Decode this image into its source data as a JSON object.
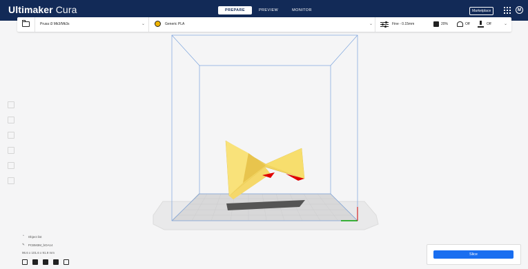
{
  "header": {
    "brand_bold": "Ultimaker",
    "brand_thin": "Cura",
    "tabs": [
      {
        "label": "PREPARE",
        "active": true
      },
      {
        "label": "PREVIEW",
        "active": false
      },
      {
        "label": "MONITOR",
        "active": false
      }
    ],
    "marketplace_label": "Marketplace",
    "account_initial": "M"
  },
  "toolbar": {
    "printer": "Prusa i3 Mk3/Mk3s",
    "material": "Generic PLA",
    "profile": "Fine - 0.15mm",
    "infill": "20%",
    "support": "Off",
    "adhesion": "Off"
  },
  "object": {
    "list_label": "Object list",
    "name": "PCBM3M_bOA14",
    "dimensions": "96.6 x 101.6 x 91.9 mm"
  },
  "slice": {
    "button_label": "Slice"
  },
  "colors": {
    "header": "#122a57",
    "accent": "#196ef0",
    "model": "#f9e27a",
    "model_overhang": "#e00000"
  }
}
